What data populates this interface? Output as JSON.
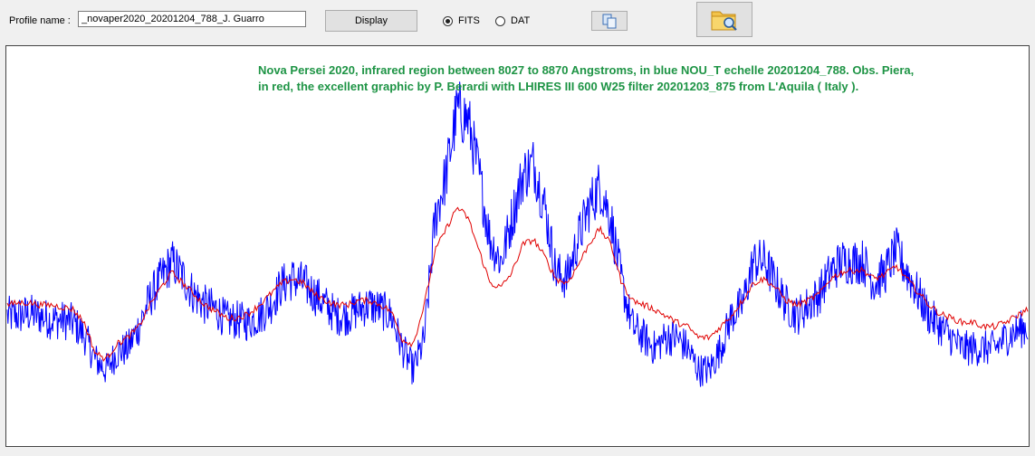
{
  "toolbar": {
    "profile_label": "Profile name :",
    "profile_value": "_novaper2020_20201204_788_J. Guarro",
    "display_label": "Display",
    "radio_fits": "FITS",
    "radio_dat": "DAT",
    "selected_format": "FITS",
    "copy_icon": "copy-icon",
    "open_icon": "folder-search-icon"
  },
  "plot": {
    "caption_line1": "Nova Persei 2020, infrared region between 8027 to 8870 Angstroms, in blue NOU_T echelle 20201204_788. Obs. Piera,",
    "caption_line2": "in red, the excellent graphic by P. Berardi with LHIRES III 600   W25 filter   20201203_875  from L'Aquila  ( Italy ).",
    "caption_color": "#1e9445"
  },
  "chart_data": {
    "type": "line",
    "xlabel": "",
    "ylabel": "",
    "grid": false,
    "x_range_angstrom": [
      8027,
      8870
    ],
    "series": [
      {
        "color": "#0000ff",
        "noisy": true,
        "profile": [
          0.55,
          0.55,
          0.56,
          0.55,
          0.53,
          0.53,
          0.52,
          0.46,
          0.35,
          0.3,
          0.38,
          0.4,
          0.5,
          0.63,
          0.72,
          0.8,
          0.73,
          0.65,
          0.6,
          0.58,
          0.53,
          0.53,
          0.52,
          0.55,
          0.6,
          0.69,
          0.72,
          0.7,
          0.65,
          0.6,
          0.55,
          0.55,
          0.58,
          0.6,
          0.58,
          0.55,
          0.4,
          0.3,
          0.44,
          1.0,
          1.2,
          1.5,
          1.45,
          1.2,
          0.9,
          0.8,
          1.0,
          1.2,
          1.25,
          1.05,
          0.75,
          0.72,
          0.9,
          1.05,
          1.15,
          1.0,
          0.7,
          0.5,
          0.45,
          0.4,
          0.45,
          0.45,
          0.4,
          0.3,
          0.3,
          0.4,
          0.55,
          0.6,
          0.8,
          0.8,
          0.7,
          0.6,
          0.55,
          0.6,
          0.65,
          0.75,
          0.8,
          0.8,
          0.8,
          0.7,
          0.75,
          0.85,
          0.75,
          0.65,
          0.55,
          0.5,
          0.45,
          0.4,
          0.4,
          0.4,
          0.4,
          0.45,
          0.48,
          0.5
        ]
      },
      {
        "color": "#e00000",
        "noisy": false,
        "profile": [
          0.6,
          0.61,
          0.61,
          0.6,
          0.6,
          0.59,
          0.58,
          0.52,
          0.38,
          0.35,
          0.42,
          0.45,
          0.5,
          0.6,
          0.68,
          0.75,
          0.7,
          0.65,
          0.6,
          0.57,
          0.54,
          0.54,
          0.56,
          0.6,
          0.65,
          0.7,
          0.72,
          0.7,
          0.65,
          0.62,
          0.6,
          0.6,
          0.62,
          0.62,
          0.6,
          0.57,
          0.44,
          0.42,
          0.6,
          0.85,
          0.95,
          1.05,
          1.0,
          0.85,
          0.7,
          0.68,
          0.75,
          0.88,
          0.9,
          0.82,
          0.72,
          0.7,
          0.78,
          0.88,
          0.95,
          0.88,
          0.7,
          0.62,
          0.6,
          0.58,
          0.55,
          0.52,
          0.5,
          0.45,
          0.45,
          0.5,
          0.55,
          0.62,
          0.7,
          0.72,
          0.68,
          0.62,
          0.6,
          0.62,
          0.65,
          0.72,
          0.75,
          0.76,
          0.76,
          0.72,
          0.74,
          0.78,
          0.72,
          0.66,
          0.6,
          0.56,
          0.54,
          0.52,
          0.52,
          0.5,
          0.5,
          0.52,
          0.55,
          0.58
        ]
      }
    ]
  }
}
